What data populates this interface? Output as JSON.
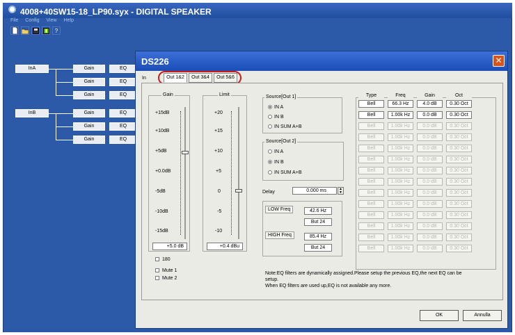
{
  "window": {
    "title": "4008+40SW15-18_LP90.syx - DIGITAL SPEAKER"
  },
  "menu": [
    "File",
    "Config",
    "View",
    "Help"
  ],
  "toolbar": {
    "icons": [
      "new-file-icon",
      "open-folder-icon",
      "save-icon",
      "device-icon",
      "help-icon"
    ],
    "help_glyph": "?"
  },
  "routing": {
    "inputs": [
      "InA",
      "InB"
    ],
    "gain_label": "Gain",
    "eq_label": "EQ"
  },
  "dialog": {
    "title": "DS226",
    "close_glyph": "✕",
    "in_label": "In",
    "tabs": [
      "Out 1&2",
      "Out 3&4",
      "Out 5&6"
    ],
    "gain": {
      "title": "Gain",
      "ticks": [
        "+15dB",
        "+10dB",
        "+5dB",
        "+0.0dB",
        "-5dB",
        "-10dB",
        "-15dB"
      ],
      "value": "+5.0 dB"
    },
    "limit": {
      "title": "Limit",
      "ticks": [
        "+20",
        "+15",
        "+10",
        "+5",
        "0",
        "-5",
        "-10"
      ],
      "value": "+0.4 dBu"
    },
    "checkboxes": [
      "180",
      "Mute 1",
      "Mute 2"
    ],
    "source1": {
      "title": "Source[Out 1]",
      "options": [
        "IN A",
        "IN B",
        "IN SUM A+B"
      ],
      "selected": "IN A"
    },
    "source2": {
      "title": "Source[Out 2]",
      "options": [
        "IN A",
        "IN B",
        "IN SUM A+B"
      ],
      "selected": "IN B"
    },
    "delay": {
      "label": "Delay",
      "value": "0.000 ms"
    },
    "crossover": {
      "low_label": "LOW Freq",
      "low_freq": "42.6 Hz",
      "low_type": "But 24",
      "high_label": "HIGH Freq",
      "high_freq": "85.4 Hz",
      "high_type": "But 24"
    },
    "eq": {
      "headers": [
        "Type",
        "Freq",
        "Gain",
        "Oct"
      ],
      "rows": [
        {
          "type": "Bell",
          "freq": "66.3 Hz",
          "gain": "4.0 dB",
          "oct": "0.30 Oct",
          "active": true
        },
        {
          "type": "Bell",
          "freq": "1.00k Hz",
          "gain": "0.0 dB",
          "oct": "0.30 Oct",
          "active": true
        },
        {
          "type": "Bell",
          "freq": "1.00k Hz",
          "gain": "0.0 dB",
          "oct": "0.30 Oct",
          "active": false
        },
        {
          "type": "Bell",
          "freq": "1.00k Hz",
          "gain": "0.0 dB",
          "oct": "0.30 Oct",
          "active": false
        },
        {
          "type": "Bell",
          "freq": "1.00k Hz",
          "gain": "0.0 dB",
          "oct": "0.30 Oct",
          "active": false
        },
        {
          "type": "Bell",
          "freq": "1.00k Hz",
          "gain": "0.0 dB",
          "oct": "0.30 Oct",
          "active": false
        },
        {
          "type": "Bell",
          "freq": "1.00k Hz",
          "gain": "0.0 dB",
          "oct": "0.30 Oct",
          "active": false
        },
        {
          "type": "Bell",
          "freq": "1.00k Hz",
          "gain": "0.0 dB",
          "oct": "0.30 Oct",
          "active": false
        },
        {
          "type": "Bell",
          "freq": "1.00k Hz",
          "gain": "0.0 dB",
          "oct": "0.30 Oct",
          "active": false
        },
        {
          "type": "Bell",
          "freq": "1.00k Hz",
          "gain": "0.0 dB",
          "oct": "0.30 Oct",
          "active": false
        },
        {
          "type": "Bell",
          "freq": "1.00k Hz",
          "gain": "0.0 dB",
          "oct": "0.30 Oct",
          "active": false
        },
        {
          "type": "Bell",
          "freq": "1.00k Hz",
          "gain": "0.0 dB",
          "oct": "0.30 Oct",
          "active": false
        },
        {
          "type": "Bell",
          "freq": "1.00k Hz",
          "gain": "0.0 dB",
          "oct": "0.30 Oct",
          "active": false
        },
        {
          "type": "Bell",
          "freq": "1.00k Hz",
          "gain": "0.0 dB",
          "oct": "0.30 Oct",
          "active": false
        }
      ]
    },
    "note": {
      "line1": "Note:EQ filters are dynamically assigned.Please setup the previous EQ,the next EQ can be",
      "line2": "setup.",
      "line3": "When EQ filters are used up,EQ is not available any more."
    },
    "ok_label": "OK",
    "cancel_label": "Annulla"
  },
  "colors": {
    "desktop": "#2d5aa8",
    "titlebar": "#1b4db6",
    "close": "#d9531c",
    "highlight_ring": "#cc1a1a"
  }
}
